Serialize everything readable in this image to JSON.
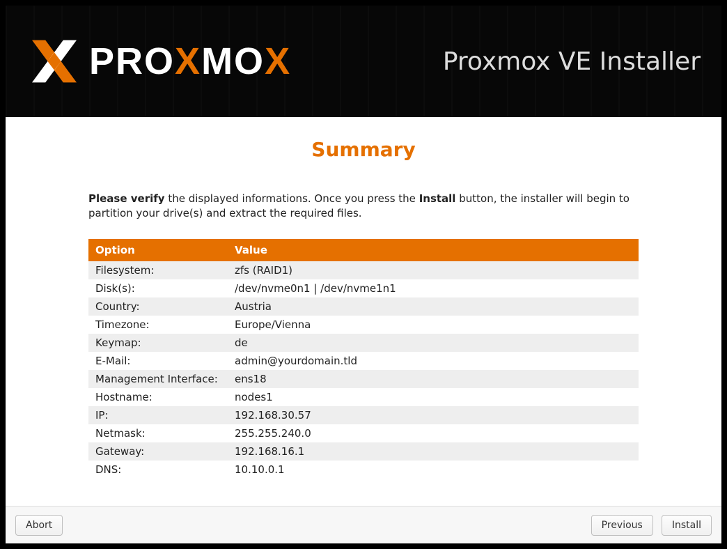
{
  "header": {
    "brand_part1": "PRO",
    "brand_part2": "X",
    "brand_part3": "MO",
    "brand_part4": "X",
    "title": "Proxmox VE Installer"
  },
  "page": {
    "title": "Summary",
    "instruction_bold1": "Please verify",
    "instruction_mid": " the displayed informations. Once you press the ",
    "instruction_bold2": "Install",
    "instruction_tail": " button, the installer will begin to partition your drive(s) and extract the required files."
  },
  "table": {
    "col_option": "Option",
    "col_value": "Value",
    "rows": [
      {
        "option": "Filesystem:",
        "value": "zfs (RAID1)"
      },
      {
        "option": "Disk(s):",
        "value": "/dev/nvme0n1 | /dev/nvme1n1"
      },
      {
        "option": "Country:",
        "value": "Austria"
      },
      {
        "option": "Timezone:",
        "value": "Europe/Vienna"
      },
      {
        "option": "Keymap:",
        "value": "de"
      },
      {
        "option": "E-Mail:",
        "value": "admin@yourdomain.tld"
      },
      {
        "option": "Management Interface:",
        "value": "ens18"
      },
      {
        "option": "Hostname:",
        "value": "nodes1"
      },
      {
        "option": "IP:",
        "value": "192.168.30.57"
      },
      {
        "option": "Netmask:",
        "value": "255.255.240.0"
      },
      {
        "option": "Gateway:",
        "value": "192.168.16.1"
      },
      {
        "option": "DNS:",
        "value": "10.10.0.1"
      }
    ]
  },
  "buttons": {
    "abort": "Abort",
    "previous": "Previous",
    "install": "Install"
  }
}
